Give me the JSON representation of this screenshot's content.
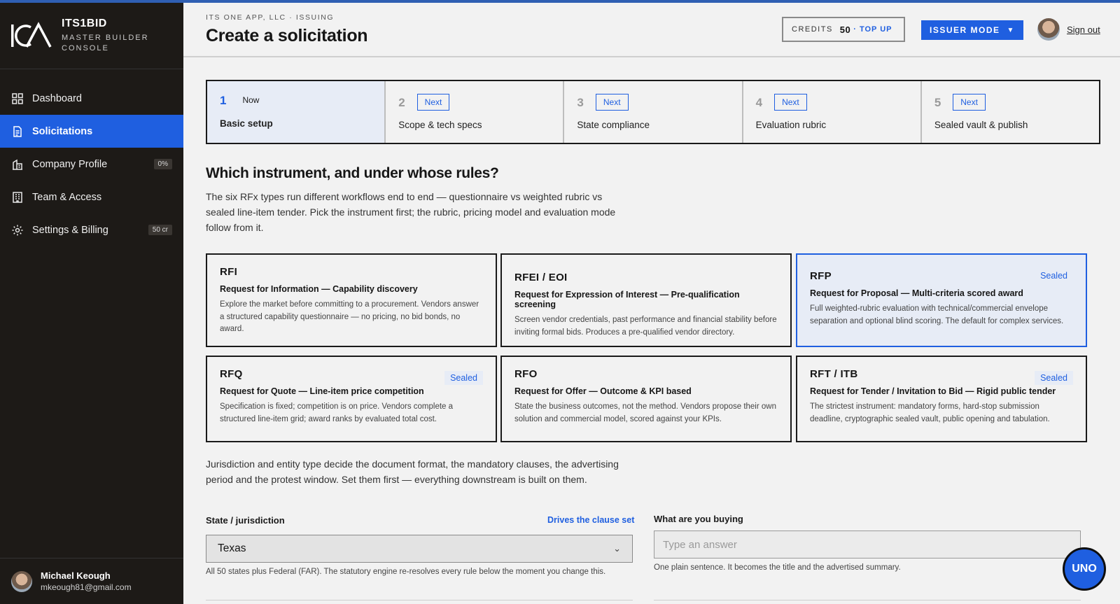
{
  "brand": {
    "name": "ITS1BID",
    "subtitle": "MASTER BUILDER CONSOLE"
  },
  "nav": [
    {
      "label": "Dashboard",
      "icon": "grid-icon",
      "badge": ""
    },
    {
      "label": "Solicitations",
      "icon": "document-icon",
      "badge": "",
      "active": true
    },
    {
      "label": "Company Profile",
      "icon": "building-icon",
      "badge": "0%"
    },
    {
      "label": "Team & Access",
      "icon": "team-icon",
      "badge": ""
    },
    {
      "label": "Settings & Billing",
      "icon": "gear-icon",
      "badge": "50 cr"
    }
  ],
  "user": {
    "name": "Michael Keough",
    "email": "mkeough81@gmail.com"
  },
  "header": {
    "breadcrumb": "ITS ONE APP, LLC · ISSUING",
    "title": "Create a solicitation",
    "credits_label": "CREDITS",
    "credits_value": "50",
    "topup": "· TOP UP",
    "mode": "ISSUER MODE",
    "signout": "Sign out"
  },
  "steps": [
    {
      "num": "1",
      "tag": "Now",
      "label": "Basic setup",
      "current": true
    },
    {
      "num": "2",
      "tag": "Next",
      "label": "Scope & tech specs"
    },
    {
      "num": "3",
      "tag": "Next",
      "label": "State compliance"
    },
    {
      "num": "4",
      "tag": "Next",
      "label": "Evaluation rubric"
    },
    {
      "num": "5",
      "tag": "Next",
      "label": "Sealed vault & publish"
    }
  ],
  "instrument": {
    "title": "Which instrument, and under whose rules?",
    "description": "The six RFx types run different workflows end to end — questionnaire vs weighted rubric vs sealed line-item tender. Pick the instrument first; the rubric, pricing model and evaluation mode follow from it."
  },
  "cards": [
    {
      "code": "RFI",
      "seal": "",
      "title": "Request for Information — Capability discovery",
      "desc": "Explore the market before committing to a procurement. Vendors answer a structured capability questionnaire — no pricing, no bid bonds, no award."
    },
    {
      "code": "RFEI / EOI",
      "seal": "",
      "title": "Request for Expression of Interest — Pre-qualification screening",
      "desc": "Screen vendor credentials, past performance and financial stability before inviting formal bids. Produces a pre-qualified vendor directory."
    },
    {
      "code": "RFP",
      "seal": "Sealed",
      "title": "Request for Proposal — Multi-criteria scored award",
      "desc": "Full weighted-rubric evaluation with technical/commercial envelope separation and optional blind scoring. The default for complex services.",
      "selected": true
    },
    {
      "code": "RFQ",
      "seal": "Sealed",
      "title": "Request for Quote — Line-item price competition",
      "desc": "Specification is fixed; competition is on price. Vendors complete a structured line-item grid; award ranks by evaluated total cost."
    },
    {
      "code": "RFO",
      "seal": "",
      "title": "Request for Offer — Outcome & KPI based",
      "desc": "State the business outcomes, not the method. Vendors propose their own solution and commercial model, scored against your KPIs."
    },
    {
      "code": "RFT / ITB",
      "seal": "Sealed",
      "title": "Request for Tender / Invitation to Bid — Rigid public tender",
      "desc": "The strictest instrument: mandatory forms, hard-stop submission deadline, cryptographic sealed vault, public opening and tabulation."
    }
  ],
  "jurisdiction": {
    "description": "Jurisdiction and entity type decide the document format, the mandatory clauses, the advertising period and the protest window. Set them first — everything downstream is built on them.",
    "label": "State / jurisdiction",
    "note": "Drives the clause set",
    "value": "Texas",
    "help": "All 50 states plus Federal (FAR). The statutory engine re-resolves every rule below the moment you change this."
  },
  "buying": {
    "label": "What are you buying",
    "placeholder": "Type an answer",
    "help": "One plain sentence. It becomes the title and the advertised summary."
  },
  "assistant": {
    "label": "UNO"
  },
  "colors": {
    "accent": "#1f5fe0",
    "sidebar": "#1d1a17",
    "background": "#f2f2f2"
  }
}
